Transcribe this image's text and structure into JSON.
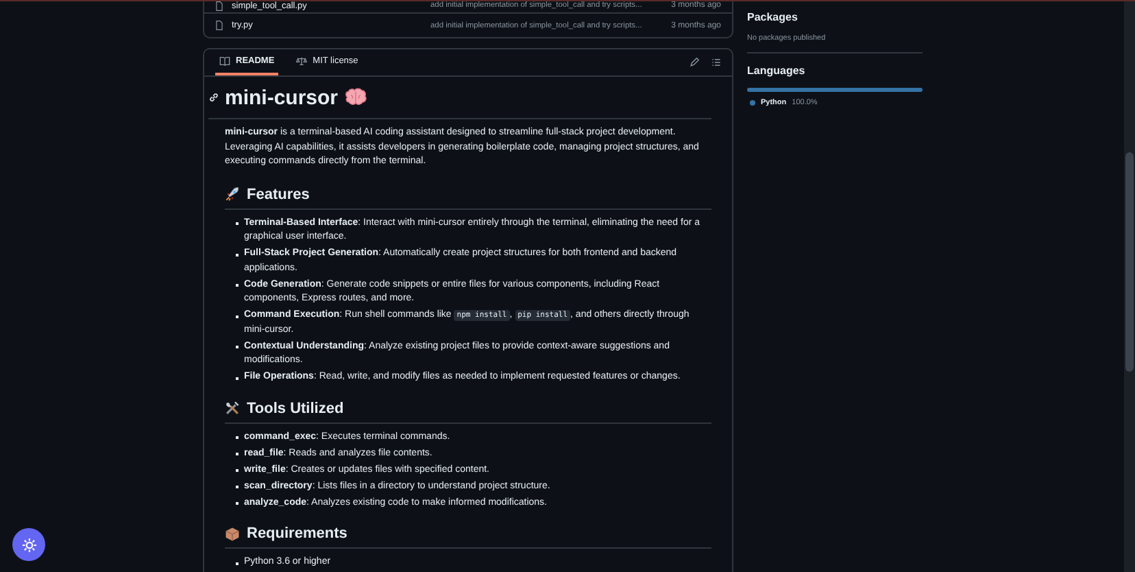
{
  "files": [
    {
      "name": "simple_tool_call.py",
      "message": "add initial implementation of simple_tool_call and try scripts...",
      "time": "3 months ago"
    },
    {
      "name": "try.py",
      "message": "add initial implementation of simple_tool_call and try scripts...",
      "time": "3 months ago"
    }
  ],
  "readme": {
    "tabs": [
      {
        "label": "README",
        "selected": true
      },
      {
        "label": "MIT license",
        "selected": false
      }
    ],
    "title": "mini-cursor",
    "intro": "**mini-cursor** is a terminal-based AI coding assistant designed to streamline full-stack project development. Leveraging AI capabilities, it assists developers in generating boilerplate code, managing project structures, and executing commands directly from the terminal.",
    "sections": [
      {
        "heading": "Features",
        "items": [
          [
            {
              "kind": "text",
              "text": "**Terminal-Based Interface**: Interact with mini-cursor entirely through the terminal, eliminating the need for a graphical user interface."
            }
          ],
          [
            {
              "kind": "text",
              "text": "**Full-Stack Project Generation**: Automatically create project structures for both frontend and backend applications."
            }
          ],
          [
            {
              "kind": "text",
              "text": "**Code Generation**: Generate code snippets or entire files for various components, including React components, Express routes, and more."
            }
          ],
          [
            {
              "kind": "text",
              "text": "**Command Execution**: Run shell commands like "
            },
            {
              "kind": "code",
              "text": "npm install"
            },
            {
              "kind": "text",
              "text": ", "
            },
            {
              "kind": "code",
              "text": "pip install"
            },
            {
              "kind": "text",
              "text": ", and others directly through mini-cursor."
            }
          ],
          [
            {
              "kind": "text",
              "text": "**Contextual Understanding**: Analyze existing project files to provide context-aware suggestions and modifications."
            }
          ],
          [
            {
              "kind": "text",
              "text": "**File Operations**: Read, write, and modify files as needed to implement requested features or changes."
            }
          ]
        ]
      },
      {
        "heading": "Tools Utilized",
        "items": [
          [
            {
              "kind": "text",
              "text": "**command_exec**: Executes terminal commands."
            }
          ],
          [
            {
              "kind": "text",
              "text": "**read_file**: Reads and analyzes file contents."
            }
          ],
          [
            {
              "kind": "text",
              "text": "**write_file**: Creates or updates files with specified content."
            }
          ],
          [
            {
              "kind": "text",
              "text": "**scan_directory**: Lists files in a directory to understand project structure."
            }
          ],
          [
            {
              "kind": "text",
              "text": "**analyze_code**: Analyzes existing code to make informed modifications."
            }
          ]
        ]
      },
      {
        "heading": "Requirements",
        "items": [
          [
            {
              "kind": "text",
              "text": "Python 3.6 or higher"
            }
          ]
        ]
      }
    ]
  },
  "sidebar": {
    "packages": {
      "heading": "Packages",
      "note": "No packages published"
    },
    "languages": {
      "heading": "Languages",
      "items": [
        {
          "name": "Python",
          "percent": "100.0%",
          "level": 1,
          "color": "#3572a5"
        }
      ]
    }
  }
}
